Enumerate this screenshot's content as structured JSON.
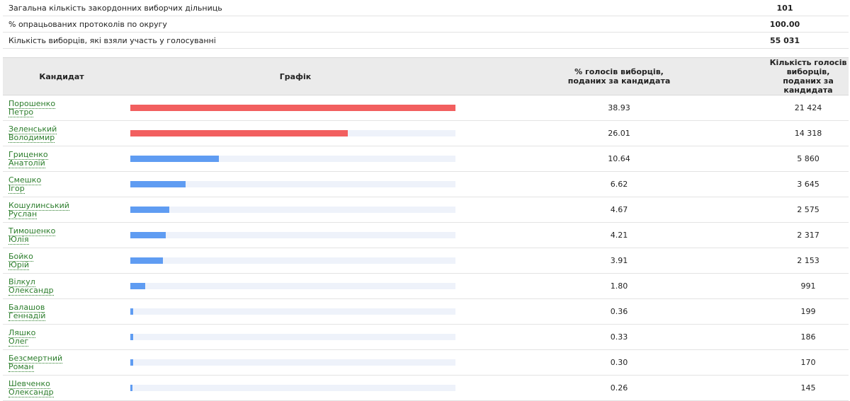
{
  "summary": [
    {
      "label": "Загальна кількість закордонних виборчих дільниць",
      "value": "101"
    },
    {
      "label": "% опрацьованих протоколів по округу",
      "value": "100.00"
    },
    {
      "label": "Кількість виборців, які взяли участь у голосуванні",
      "value": "55 031"
    }
  ],
  "headers": {
    "candidate": "Кандидат",
    "graph": "Графік",
    "percent_line1": "% голосів виборців,",
    "percent_line2": "поданих за кандидата",
    "count_line1": "Кількість голосів виборців,",
    "count_line2": "поданих за кандидата"
  },
  "colors": {
    "top": "#f25f5f",
    "other": "#5f9cf2",
    "track": "#eef2fa",
    "link": "#2b7d2b"
  },
  "candidates": [
    {
      "surname": "Порошенко",
      "given": "Петро",
      "percent": "38.93",
      "votes": "21 424",
      "top": true
    },
    {
      "surname": "Зеленський",
      "given": "Володимир",
      "percent": "26.01",
      "votes": "14 318",
      "top": true
    },
    {
      "surname": "Гриценко",
      "given": "Анатолій",
      "percent": "10.64",
      "votes": "5 860",
      "top": false
    },
    {
      "surname": "Смешко",
      "given": "Ігор",
      "percent": "6.62",
      "votes": "3 645",
      "top": false
    },
    {
      "surname": "Кошулинський",
      "given": "Руслан",
      "percent": "4.67",
      "votes": "2 575",
      "top": false
    },
    {
      "surname": "Тимошенко",
      "given": "Юлія",
      "percent": "4.21",
      "votes": "2 317",
      "top": false
    },
    {
      "surname": "Бойко",
      "given": "Юрій",
      "percent": "3.91",
      "votes": "2 153",
      "top": false
    },
    {
      "surname": "Вілкул",
      "given": "Олександр",
      "percent": "1.80",
      "votes": "991",
      "top": false
    },
    {
      "surname": "Балашов",
      "given": "Геннадій",
      "percent": "0.36",
      "votes": "199",
      "top": false
    },
    {
      "surname": "Ляшко",
      "given": "Олег",
      "percent": "0.33",
      "votes": "186",
      "top": false
    },
    {
      "surname": "Безсмертний",
      "given": "Роман",
      "percent": "0.30",
      "votes": "170",
      "top": false
    },
    {
      "surname": "Шевченко",
      "given": "Олександр",
      "percent": "0.26",
      "votes": "145",
      "top": false
    }
  ]
}
